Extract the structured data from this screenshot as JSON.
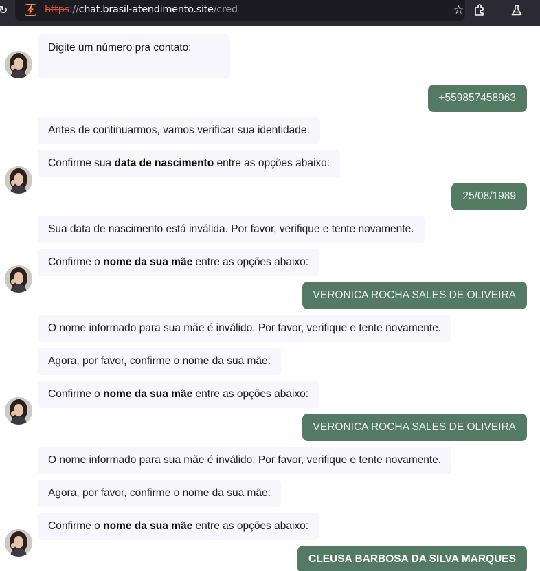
{
  "browser": {
    "url_scheme": "https",
    "url_sep": "://",
    "url_host": "chat.brasil-atendimento.site",
    "url_path": "/cred"
  },
  "messages": [
    {
      "from": "bot",
      "avatar": true,
      "parts": [
        {
          "t": "Digite um número pra contato:"
        }
      ]
    },
    {
      "from": "user",
      "text": "+559857458963"
    },
    {
      "from": "bot",
      "avatar": false,
      "parts": [
        {
          "t": "Antes de continuarmos, vamos verificar sua identidade."
        }
      ]
    },
    {
      "from": "bot",
      "avatar": true,
      "parts": [
        {
          "t": "Confirme sua "
        },
        {
          "t": "data de nascimento",
          "b": true
        },
        {
          "t": " entre as opções abaixo:"
        }
      ]
    },
    {
      "from": "user",
      "text": "25/08/1989"
    },
    {
      "from": "bot",
      "avatar": false,
      "parts": [
        {
          "t": "Sua data de nascimento está inválida. Por favor, verifique e tente novamente."
        }
      ]
    },
    {
      "from": "bot",
      "avatar": true,
      "parts": [
        {
          "t": "Confirme o "
        },
        {
          "t": "nome da sua mãe",
          "b": true
        },
        {
          "t": " entre as opções abaixo:"
        }
      ]
    },
    {
      "from": "user",
      "text": "VERONICA ROCHA SALES DE OLIVEIRA"
    },
    {
      "from": "bot",
      "avatar": false,
      "parts": [
        {
          "t": "O nome informado para sua mãe é inválido. Por favor, verifique e tente novamente."
        }
      ]
    },
    {
      "from": "bot",
      "avatar": false,
      "parts": [
        {
          "t": "Agora, por favor, confirme o nome da sua mãe:"
        }
      ]
    },
    {
      "from": "bot",
      "avatar": true,
      "parts": [
        {
          "t": "Confirme o "
        },
        {
          "t": "nome da sua mãe",
          "b": true
        },
        {
          "t": " entre as opções abaixo:"
        }
      ]
    },
    {
      "from": "user",
      "text": "VERONICA ROCHA SALES DE OLIVEIRA"
    },
    {
      "from": "bot",
      "avatar": false,
      "parts": [
        {
          "t": "O nome informado para sua mãe é inválido. Por favor, verifique e tente novamente."
        }
      ]
    },
    {
      "from": "bot",
      "avatar": false,
      "parts": [
        {
          "t": "Agora, por favor, confirme o nome da sua mãe:"
        }
      ]
    },
    {
      "from": "bot",
      "avatar": true,
      "parts": [
        {
          "t": "Confirme o "
        },
        {
          "t": "nome da sua mãe",
          "b": true
        },
        {
          "t": " entre as opções abaixo:"
        }
      ]
    },
    {
      "from": "user",
      "text": "CLEUSA BARBOSA DA SILVA MARQUES",
      "bold": true
    }
  ],
  "colors": {
    "bot_bubble": "#f6f6fc",
    "user_bubble": "#557a63",
    "chrome_bg": "#2b2a33"
  }
}
